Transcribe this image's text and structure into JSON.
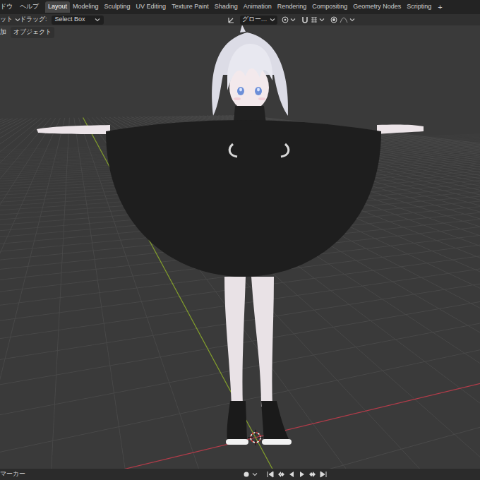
{
  "menu": [
    "ドウ",
    "ヘルプ"
  ],
  "workspaces": [
    {
      "label": "Layout",
      "selected": true
    },
    {
      "label": "Modeling",
      "selected": false
    },
    {
      "label": "Sculpting",
      "selected": false
    },
    {
      "label": "UV Editing",
      "selected": false
    },
    {
      "label": "Texture Paint",
      "selected": false
    },
    {
      "label": "Shading",
      "selected": false
    },
    {
      "label": "Animation",
      "selected": false
    },
    {
      "label": "Rendering",
      "selected": false
    },
    {
      "label": "Compositing",
      "selected": false
    },
    {
      "label": "Geometry Nodes",
      "selected": false
    },
    {
      "label": "Scripting",
      "selected": false
    }
  ],
  "add_workspace": "+",
  "tool_header": {
    "mode_fragment": "ット",
    "drag_label": "ドラッグ:",
    "drag_value": "Select Box",
    "orientation": "グロー…"
  },
  "viewport_header": {
    "add_fragment": "加",
    "object_menu": "オブジェクト"
  },
  "timeline": {
    "marker_menu": "マーカー"
  }
}
